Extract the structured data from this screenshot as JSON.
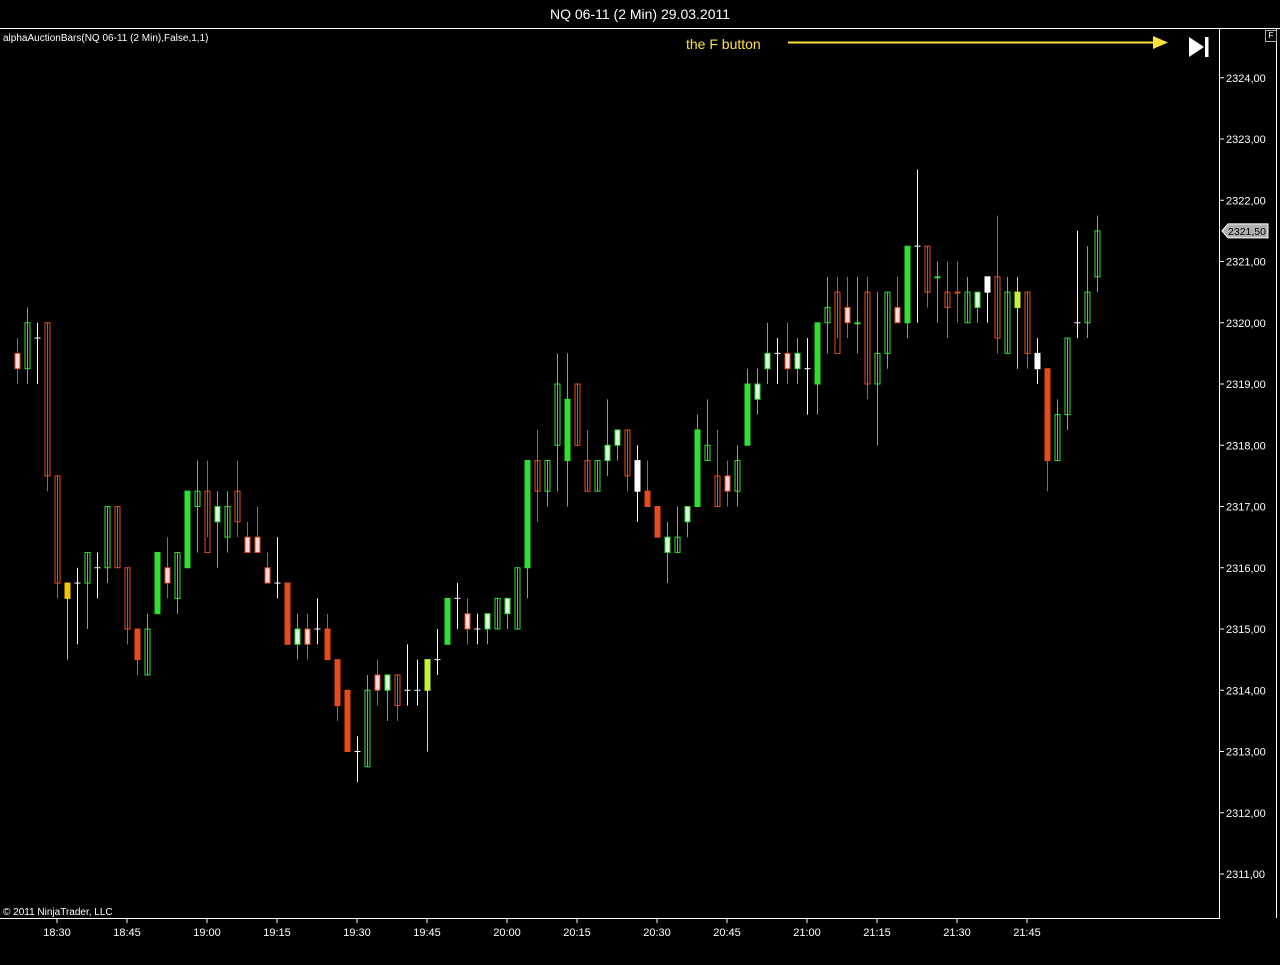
{
  "window": {
    "title": "NQ 06-11 (2 Min)  29.03.2011"
  },
  "indicator_label": "alphaAuctionBars(NQ 06-11 (2 Min),False,1,1)",
  "copyright": "© 2011 NinjaTrader, LLC",
  "annotation": {
    "text": "the F button",
    "color": "#ffe13a"
  },
  "f_button_label": "F",
  "skip_button_icon": "skip-to-end-icon",
  "colors": {
    "bull": "#2ee12e",
    "bear": "#e84a1a",
    "neutral_bull": "#d8fcd8",
    "neutral_bear": "#fcd8d8",
    "doji": "#ffffff",
    "yellow": "#f5c400",
    "lime": "#c4f53a",
    "axis": "#ffffff",
    "price_marker": "#b0b0b0"
  },
  "chart_data": {
    "type": "candlestick",
    "title": "NQ 06-11 (2 Min)  29.03.2011",
    "ylim": [
      2310.5,
      2324.75
    ],
    "y_ticks": [
      "2311,00",
      "2312,00",
      "2313,00",
      "2314,00",
      "2315,00",
      "2316,00",
      "2317,00",
      "2318,00",
      "2319,00",
      "2320,00",
      "2321,00",
      "2322,00",
      "2323,00",
      "2324,00"
    ],
    "y_tick_values": [
      2311,
      2312,
      2313,
      2314,
      2315,
      2316,
      2317,
      2318,
      2319,
      2320,
      2321,
      2322,
      2323,
      2324
    ],
    "x_labels": [
      "18:30",
      "18:45",
      "19:00",
      "19:15",
      "19:30",
      "19:45",
      "20:00",
      "20:15",
      "20:30",
      "20:45",
      "21:00",
      "21:15",
      "21:30",
      "21:45"
    ],
    "x_label_bar_index": [
      4,
      11,
      19,
      26,
      34,
      41,
      49,
      56,
      64,
      71,
      79,
      86,
      94,
      101
    ],
    "last_price": "2321,50",
    "last_price_value": 2321.5,
    "bars": [
      {
        "o": 2319.5,
        "h": 2319.75,
        "l": 2319.0,
        "c": 2319.25,
        "s": "nbear"
      },
      {
        "o": 2319.25,
        "h": 2320.25,
        "l": 2319.0,
        "c": 2320.0,
        "s": "bull_h"
      },
      {
        "o": 2319.75,
        "h": 2320.0,
        "l": 2319.0,
        "c": 2319.75,
        "s": "doji"
      },
      {
        "o": 2320.0,
        "h": 2320.0,
        "l": 2317.25,
        "c": 2317.5,
        "s": "bear_h"
      },
      {
        "o": 2317.5,
        "h": 2317.5,
        "l": 2315.5,
        "c": 2315.75,
        "s": "bear_h"
      },
      {
        "o": 2315.75,
        "h": 2315.75,
        "l": 2314.5,
        "c": 2315.5,
        "s": "yellow"
      },
      {
        "o": 2315.75,
        "h": 2316.0,
        "l": 2314.75,
        "c": 2315.75,
        "s": "doji"
      },
      {
        "o": 2315.75,
        "h": 2316.25,
        "l": 2315.0,
        "c": 2316.25,
        "s": "bull_h"
      },
      {
        "o": 2316.0,
        "h": 2316.25,
        "l": 2315.5,
        "c": 2316.0,
        "s": "doji"
      },
      {
        "o": 2316.0,
        "h": 2317.0,
        "l": 2315.75,
        "c": 2317.0,
        "s": "bull_h"
      },
      {
        "o": 2317.0,
        "h": 2317.0,
        "l": 2316.0,
        "c": 2316.0,
        "s": "bear_h"
      },
      {
        "o": 2316.0,
        "h": 2316.0,
        "l": 2314.75,
        "c": 2315.0,
        "s": "bear_h"
      },
      {
        "o": 2315.0,
        "h": 2315.0,
        "l": 2314.25,
        "c": 2314.5,
        "s": "bear"
      },
      {
        "o": 2314.25,
        "h": 2315.25,
        "l": 2314.25,
        "c": 2315.0,
        "s": "bull_h"
      },
      {
        "o": 2315.25,
        "h": 2316.25,
        "l": 2315.25,
        "c": 2316.25,
        "s": "bull"
      },
      {
        "o": 2316.0,
        "h": 2316.5,
        "l": 2315.5,
        "c": 2315.75,
        "s": "nbear"
      },
      {
        "o": 2315.5,
        "h": 2316.25,
        "l": 2315.25,
        "c": 2316.25,
        "s": "bull_h"
      },
      {
        "o": 2316.0,
        "h": 2317.25,
        "l": 2316.0,
        "c": 2317.25,
        "s": "bull"
      },
      {
        "o": 2317.0,
        "h": 2317.75,
        "l": 2316.25,
        "c": 2317.25,
        "s": "bull_h"
      },
      {
        "o": 2317.25,
        "h": 2317.75,
        "l": 2316.5,
        "c": 2316.25,
        "s": "bear_h"
      },
      {
        "o": 2317.0,
        "h": 2317.25,
        "l": 2316.0,
        "c": 2316.75,
        "s": "nbull"
      },
      {
        "o": 2316.5,
        "h": 2317.25,
        "l": 2316.25,
        "c": 2317.0,
        "s": "bull_h"
      },
      {
        "o": 2317.25,
        "h": 2317.75,
        "l": 2316.5,
        "c": 2316.75,
        "s": "bear_h"
      },
      {
        "o": 2316.5,
        "h": 2316.75,
        "l": 2316.25,
        "c": 2316.25,
        "s": "nbear"
      },
      {
        "o": 2316.5,
        "h": 2317.0,
        "l": 2316.25,
        "c": 2316.25,
        "s": "nbear"
      },
      {
        "o": 2316.0,
        "h": 2316.25,
        "l": 2315.75,
        "c": 2315.75,
        "s": "nbear"
      },
      {
        "o": 2315.75,
        "h": 2316.5,
        "l": 2315.5,
        "c": 2315.75,
        "s": "doji"
      },
      {
        "o": 2315.75,
        "h": 2315.75,
        "l": 2314.75,
        "c": 2314.75,
        "s": "bear"
      },
      {
        "o": 2314.75,
        "h": 2315.25,
        "l": 2314.5,
        "c": 2315.0,
        "s": "nbull"
      },
      {
        "o": 2315.0,
        "h": 2315.25,
        "l": 2314.5,
        "c": 2314.75,
        "s": "nbear"
      },
      {
        "o": 2315.0,
        "h": 2315.5,
        "l": 2314.75,
        "c": 2315.0,
        "s": "doji"
      },
      {
        "o": 2315.0,
        "h": 2315.25,
        "l": 2314.5,
        "c": 2314.5,
        "s": "bear"
      },
      {
        "o": 2314.5,
        "h": 2314.5,
        "l": 2313.5,
        "c": 2313.75,
        "s": "bear"
      },
      {
        "o": 2314.0,
        "h": 2314.0,
        "l": 2313.0,
        "c": 2313.0,
        "s": "bear"
      },
      {
        "o": 2313.0,
        "h": 2313.25,
        "l": 2312.5,
        "c": 2313.0,
        "s": "doji"
      },
      {
        "o": 2312.75,
        "h": 2314.25,
        "l": 2312.75,
        "c": 2314.0,
        "s": "bull_h"
      },
      {
        "o": 2314.25,
        "h": 2314.5,
        "l": 2313.75,
        "c": 2314.0,
        "s": "nbear"
      },
      {
        "o": 2314.0,
        "h": 2314.25,
        "l": 2313.5,
        "c": 2314.25,
        "s": "nbull"
      },
      {
        "o": 2314.25,
        "h": 2314.25,
        "l": 2313.5,
        "c": 2313.75,
        "s": "bear_h"
      },
      {
        "o": 2314.0,
        "h": 2314.75,
        "l": 2313.75,
        "c": 2314.0,
        "s": "doji"
      },
      {
        "o": 2314.0,
        "h": 2314.5,
        "l": 2313.75,
        "c": 2314.0,
        "s": "doji"
      },
      {
        "o": 2314.0,
        "h": 2314.5,
        "l": 2313.0,
        "c": 2314.5,
        "s": "lime"
      },
      {
        "o": 2314.5,
        "h": 2315.0,
        "l": 2314.25,
        "c": 2314.5,
        "s": "doji"
      },
      {
        "o": 2314.75,
        "h": 2315.5,
        "l": 2314.75,
        "c": 2315.5,
        "s": "bull"
      },
      {
        "o": 2315.5,
        "h": 2315.75,
        "l": 2315.0,
        "c": 2315.5,
        "s": "doji"
      },
      {
        "o": 2315.25,
        "h": 2315.5,
        "l": 2314.75,
        "c": 2315.0,
        "s": "nbear"
      },
      {
        "o": 2315.0,
        "h": 2315.25,
        "l": 2314.75,
        "c": 2315.0,
        "s": "doji"
      },
      {
        "o": 2315.0,
        "h": 2315.25,
        "l": 2314.75,
        "c": 2315.25,
        "s": "nbull"
      },
      {
        "o": 2315.0,
        "h": 2315.5,
        "l": 2315.0,
        "c": 2315.5,
        "s": "bull_h"
      },
      {
        "o": 2315.25,
        "h": 2315.5,
        "l": 2315.0,
        "c": 2315.5,
        "s": "nbull"
      },
      {
        "o": 2315.0,
        "h": 2316.0,
        "l": 2315.0,
        "c": 2316.0,
        "s": "bull_h"
      },
      {
        "o": 2316.0,
        "h": 2317.75,
        "l": 2315.5,
        "c": 2317.75,
        "s": "bull"
      },
      {
        "o": 2317.75,
        "h": 2318.25,
        "l": 2316.75,
        "c": 2317.25,
        "s": "bear_h"
      },
      {
        "o": 2317.25,
        "h": 2317.75,
        "l": 2317.0,
        "c": 2317.75,
        "s": "bull_h"
      },
      {
        "o": 2318.0,
        "h": 2319.5,
        "l": 2317.25,
        "c": 2319.0,
        "s": "bull_h"
      },
      {
        "o": 2317.75,
        "h": 2319.5,
        "l": 2317.0,
        "c": 2318.75,
        "s": "bull"
      },
      {
        "o": 2319.0,
        "h": 2319.0,
        "l": 2318.0,
        "c": 2318.0,
        "s": "bear_h"
      },
      {
        "o": 2317.75,
        "h": 2318.25,
        "l": 2317.25,
        "c": 2317.25,
        "s": "bear_h"
      },
      {
        "o": 2317.25,
        "h": 2317.75,
        "l": 2317.25,
        "c": 2317.75,
        "s": "bull_h"
      },
      {
        "o": 2317.75,
        "h": 2318.75,
        "l": 2317.5,
        "c": 2318.0,
        "s": "nbull"
      },
      {
        "o": 2318.0,
        "h": 2318.25,
        "l": 2317.75,
        "c": 2318.25,
        "s": "nbull"
      },
      {
        "o": 2318.25,
        "h": 2318.25,
        "l": 2317.25,
        "c": 2317.5,
        "s": "bear_h"
      },
      {
        "o": 2317.75,
        "h": 2318.0,
        "l": 2316.75,
        "c": 2317.25,
        "s": "doji"
      },
      {
        "o": 2317.25,
        "h": 2317.75,
        "l": 2317.0,
        "c": 2317.0,
        "s": "bear"
      },
      {
        "o": 2317.0,
        "h": 2317.0,
        "l": 2316.5,
        "c": 2316.5,
        "s": "bear"
      },
      {
        "o": 2316.25,
        "h": 2316.75,
        "l": 2315.75,
        "c": 2316.5,
        "s": "nbull"
      },
      {
        "o": 2316.25,
        "h": 2317.0,
        "l": 2316.25,
        "c": 2316.5,
        "s": "bull_h"
      },
      {
        "o": 2316.75,
        "h": 2317.0,
        "l": 2316.5,
        "c": 2317.0,
        "s": "nbull"
      },
      {
        "o": 2317.0,
        "h": 2318.5,
        "l": 2317.0,
        "c": 2318.25,
        "s": "bull"
      },
      {
        "o": 2317.75,
        "h": 2318.75,
        "l": 2317.75,
        "c": 2318.0,
        "s": "bull_h"
      },
      {
        "o": 2317.5,
        "h": 2318.25,
        "l": 2317.0,
        "c": 2317.0,
        "s": "bear_h"
      },
      {
        "o": 2317.25,
        "h": 2317.75,
        "l": 2317.0,
        "c": 2317.5,
        "s": "nbear"
      },
      {
        "o": 2317.25,
        "h": 2318.0,
        "l": 2317.0,
        "c": 2317.75,
        "s": "bull_h"
      },
      {
        "o": 2318.0,
        "h": 2319.25,
        "l": 2318.0,
        "c": 2319.0,
        "s": "bull"
      },
      {
        "o": 2318.75,
        "h": 2319.25,
        "l": 2318.5,
        "c": 2319.0,
        "s": "nbull"
      },
      {
        "o": 2319.25,
        "h": 2320.0,
        "l": 2319.0,
        "c": 2319.5,
        "s": "nbull"
      },
      {
        "o": 2319.5,
        "h": 2319.75,
        "l": 2319.0,
        "c": 2319.5,
        "s": "doji"
      },
      {
        "o": 2319.5,
        "h": 2320.0,
        "l": 2319.0,
        "c": 2319.25,
        "s": "nbear"
      },
      {
        "o": 2319.25,
        "h": 2319.75,
        "l": 2319.0,
        "c": 2319.5,
        "s": "nbull"
      },
      {
        "o": 2319.25,
        "h": 2319.75,
        "l": 2318.5,
        "c": 2319.25,
        "s": "doji"
      },
      {
        "o": 2319.0,
        "h": 2320.0,
        "l": 2318.5,
        "c": 2320.0,
        "s": "bull"
      },
      {
        "o": 2320.0,
        "h": 2320.75,
        "l": 2319.5,
        "c": 2320.25,
        "s": "bull_h"
      },
      {
        "o": 2320.5,
        "h": 2320.75,
        "l": 2319.75,
        "c": 2319.5,
        "s": "bear_h"
      },
      {
        "o": 2320.25,
        "h": 2320.75,
        "l": 2319.75,
        "c": 2320.0,
        "s": "nbear"
      },
      {
        "o": 2320.0,
        "h": 2320.75,
        "l": 2319.5,
        "c": 2320.0,
        "s": "bull_h"
      },
      {
        "o": 2320.5,
        "h": 2320.75,
        "l": 2318.75,
        "c": 2319.0,
        "s": "bear_h"
      },
      {
        "o": 2319.5,
        "h": 2320.5,
        "l": 2318.0,
        "c": 2319.0,
        "s": "bull_h"
      },
      {
        "o": 2319.5,
        "h": 2320.5,
        "l": 2319.25,
        "c": 2320.5,
        "s": "bull_h"
      },
      {
        "o": 2320.25,
        "h": 2320.75,
        "l": 2320.0,
        "c": 2320.0,
        "s": "nbear"
      },
      {
        "o": 2320.0,
        "h": 2321.25,
        "l": 2319.75,
        "c": 2321.25,
        "s": "bull"
      },
      {
        "o": 2321.25,
        "h": 2322.5,
        "l": 2320.0,
        "c": 2321.25,
        "s": "doji"
      },
      {
        "o": 2321.25,
        "h": 2321.25,
        "l": 2320.25,
        "c": 2320.5,
        "s": "bear_h"
      },
      {
        "o": 2320.75,
        "h": 2321.0,
        "l": 2320.0,
        "c": 2320.75,
        "s": "bull_h"
      },
      {
        "o": 2320.5,
        "h": 2321.0,
        "l": 2319.75,
        "c": 2320.25,
        "s": "bear_h"
      },
      {
        "o": 2320.5,
        "h": 2321.0,
        "l": 2320.0,
        "c": 2320.5,
        "s": "nbear"
      },
      {
        "o": 2320.0,
        "h": 2320.75,
        "l": 2320.0,
        "c": 2320.5,
        "s": "bull_h"
      },
      {
        "o": 2320.25,
        "h": 2320.5,
        "l": 2320.0,
        "c": 2320.5,
        "s": "nbull"
      },
      {
        "o": 2320.5,
        "h": 2320.75,
        "l": 2320.0,
        "c": 2320.75,
        "s": "doji"
      },
      {
        "o": 2320.75,
        "h": 2321.75,
        "l": 2319.5,
        "c": 2319.75,
        "s": "bear_h"
      },
      {
        "o": 2319.5,
        "h": 2320.75,
        "l": 2319.5,
        "c": 2320.5,
        "s": "bull_h"
      },
      {
        "o": 2320.5,
        "h": 2320.75,
        "l": 2319.25,
        "c": 2320.25,
        "s": "lime"
      },
      {
        "o": 2320.5,
        "h": 2320.5,
        "l": 2319.25,
        "c": 2319.5,
        "s": "bear_h"
      },
      {
        "o": 2319.25,
        "h": 2319.75,
        "l": 2319.0,
        "c": 2319.5,
        "s": "doji"
      },
      {
        "o": 2319.25,
        "h": 2319.25,
        "l": 2317.25,
        "c": 2317.75,
        "s": "bear"
      },
      {
        "o": 2317.75,
        "h": 2318.75,
        "l": 2317.75,
        "c": 2318.5,
        "s": "bull_h"
      },
      {
        "o": 2318.5,
        "h": 2319.75,
        "l": 2318.25,
        "c": 2319.75,
        "s": "bull_h"
      },
      {
        "o": 2320.0,
        "h": 2321.5,
        "l": 2319.75,
        "c": 2320.0,
        "s": "doji"
      },
      {
        "o": 2320.0,
        "h": 2321.25,
        "l": 2319.75,
        "c": 2320.5,
        "s": "bull_h"
      },
      {
        "o": 2320.75,
        "h": 2321.75,
        "l": 2320.5,
        "c": 2321.5,
        "s": "bull_h"
      }
    ]
  }
}
